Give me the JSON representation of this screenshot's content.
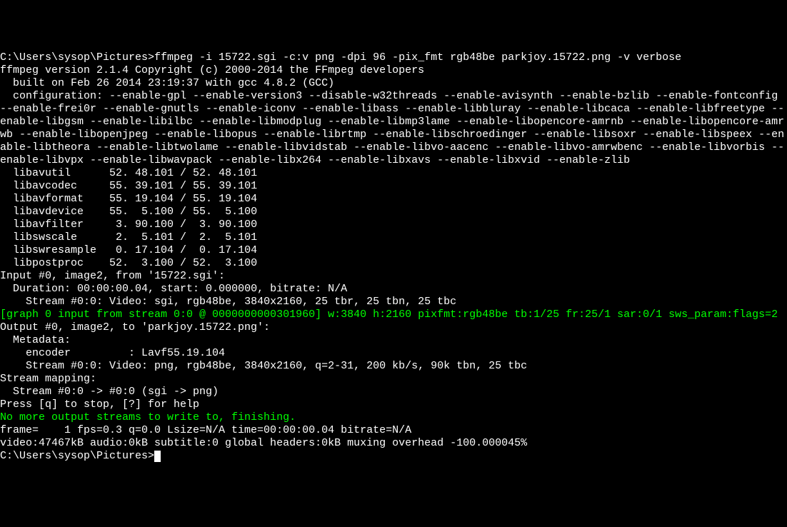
{
  "lines": [
    {
      "cls": "white",
      "text": "C:\\Users\\sysop\\Pictures>ffmpeg -i 15722.sgi -c:v png -dpi 96 -pix_fmt rgb48be parkjoy.15722.png -v verbose"
    },
    {
      "cls": "white",
      "text": "ffmpeg version 2.1.4 Copyright (c) 2000-2014 the FFmpeg developers"
    },
    {
      "cls": "white",
      "text": "  built on Feb 26 2014 23:19:37 with gcc 4.8.2 (GCC)"
    },
    {
      "cls": "white",
      "text": "  configuration: --enable-gpl --enable-version3 --disable-w32threads --enable-avisynth --enable-bzlib --enable-fontconfig --enable-frei0r --enable-gnutls --enable-iconv --enable-libass --enable-libbluray --enable-libcaca --enable-libfreetype --enable-libgsm --enable-libilbc --enable-libmodplug --enable-libmp3lame --enable-libopencore-amrnb --enable-libopencore-amrwb --enable-libopenjpeg --enable-libopus --enable-librtmp --enable-libschroedinger --enable-libsoxr --enable-libspeex --enable-libtheora --enable-libtwolame --enable-libvidstab --enable-libvo-aacenc --enable-libvo-amrwbenc --enable-libvorbis --enable-libvpx --enable-libwavpack --enable-libx264 --enable-libxavs --enable-libxvid --enable-zlib"
    },
    {
      "cls": "white",
      "text": "  libavutil      52. 48.101 / 52. 48.101"
    },
    {
      "cls": "white",
      "text": "  libavcodec     55. 39.101 / 55. 39.101"
    },
    {
      "cls": "white",
      "text": "  libavformat    55. 19.104 / 55. 19.104"
    },
    {
      "cls": "white",
      "text": "  libavdevice    55.  5.100 / 55.  5.100"
    },
    {
      "cls": "white",
      "text": "  libavfilter     3. 90.100 /  3. 90.100"
    },
    {
      "cls": "white",
      "text": "  libswscale      2.  5.101 /  2.  5.101"
    },
    {
      "cls": "white",
      "text": "  libswresample   0. 17.104 /  0. 17.104"
    },
    {
      "cls": "white",
      "text": "  libpostproc    52.  3.100 / 52.  3.100"
    },
    {
      "cls": "white",
      "text": "Input #0, image2, from '15722.sgi':"
    },
    {
      "cls": "white",
      "text": "  Duration: 00:00:00.04, start: 0.000000, bitrate: N/A"
    },
    {
      "cls": "white",
      "text": "    Stream #0:0: Video: sgi, rgb48be, 3840x2160, 25 tbr, 25 tbn, 25 tbc"
    },
    {
      "cls": "green",
      "text": "[graph 0 input from stream 0:0 @ 0000000000301960] w:3840 h:2160 pixfmt:rgb48be tb:1/25 fr:25/1 sar:0/1 sws_param:flags=2"
    },
    {
      "cls": "white",
      "text": "Output #0, image2, to 'parkjoy.15722.png':"
    },
    {
      "cls": "white",
      "text": "  Metadata:"
    },
    {
      "cls": "white",
      "text": "    encoder         : Lavf55.19.104"
    },
    {
      "cls": "white",
      "text": "    Stream #0:0: Video: png, rgb48be, 3840x2160, q=2-31, 200 kb/s, 90k tbn, 25 tbc"
    },
    {
      "cls": "white",
      "text": "Stream mapping:"
    },
    {
      "cls": "white",
      "text": "  Stream #0:0 -> #0:0 (sgi -> png)"
    },
    {
      "cls": "white",
      "text": "Press [q] to stop, [?] for help"
    },
    {
      "cls": "green",
      "text": "No more output streams to write to, finishing."
    },
    {
      "cls": "white",
      "text": "frame=    1 fps=0.3 q=0.0 Lsize=N/A time=00:00:00.04 bitrate=N/A"
    },
    {
      "cls": "white",
      "text": "video:47467kB audio:0kB subtitle:0 global headers:0kB muxing overhead -100.000045%"
    },
    {
      "cls": "white",
      "text": ""
    },
    {
      "cls": "white",
      "text": "C:\\Users\\sysop\\Pictures>",
      "cursor": true
    }
  ]
}
